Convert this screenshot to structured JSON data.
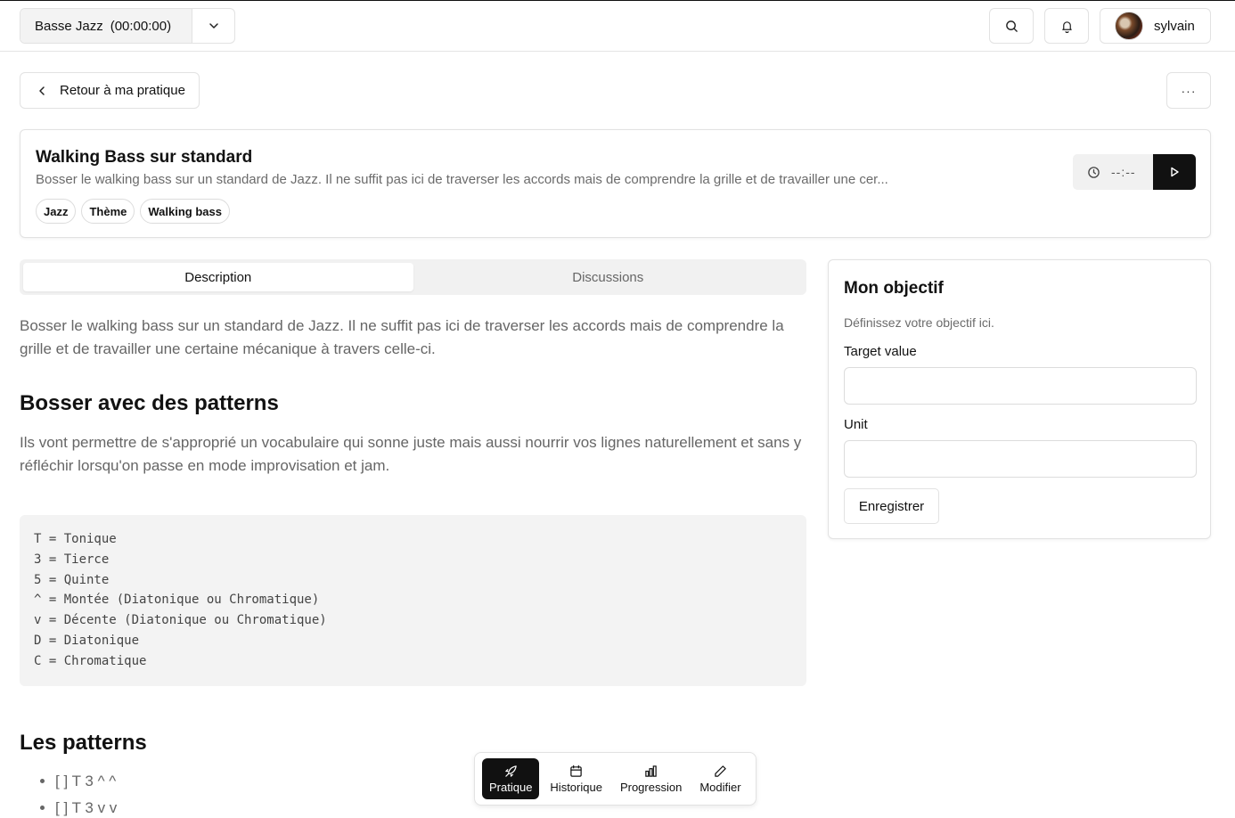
{
  "header": {
    "session_name": "Basse Jazz",
    "session_time": "(00:00:00)",
    "user_name": "sylvain"
  },
  "back": {
    "label": "Retour à ma pratique"
  },
  "more_label": "···",
  "exercise": {
    "title": "Walking Bass sur standard",
    "description": "Bosser le walking bass sur un standard de Jazz. Il ne suffit pas ici de traverser les accords mais de comprendre la grille et de travailler une cer...",
    "tags": [
      "Jazz",
      "Thème",
      "Walking bass"
    ],
    "timer": "--:--"
  },
  "tabs": [
    {
      "label": "Description",
      "active": true
    },
    {
      "label": "Discussions",
      "active": false
    }
  ],
  "content": {
    "intro": "Bosser le walking bass sur un standard de Jazz. Il ne suffit pas ici de traverser les accords mais de comprendre la grille et de travailler une certaine mécanique à travers celle-ci.",
    "h_patterns": "Bosser avec des patterns",
    "patterns_text": "Ils vont permettre de s'approprié un vocabulaire qui sonne juste mais aussi nourrir vos lignes naturellement et sans y réfléchir lorsqu'on passe en mode improvisation et jam.",
    "legend": [
      "T = Tonique",
      "3 = Tierce",
      "5 = Quinte",
      "^ = Montée (Diatonique ou Chromatique)",
      "v = Décente (Diatonique ou Chromatique)",
      "D = Diatonique",
      "C = Chromatique"
    ],
    "h_list": "Les patterns",
    "patterns": [
      "[ ] T 3 ^ ^",
      "[ ] T 3 v v"
    ]
  },
  "objective": {
    "title": "Mon objectif",
    "subtitle": "Définissez votre objectif ici.",
    "target_label": "Target value",
    "target_value": "",
    "unit_label": "Unit",
    "unit_value": "",
    "save_label": "Enregistrer"
  },
  "bottom_nav": {
    "items": [
      {
        "label": "Pratique",
        "icon": "rocket-icon",
        "active": true
      },
      {
        "label": "Historique",
        "icon": "calendar-icon",
        "active": false
      },
      {
        "label": "Progression",
        "icon": "bar-chart-icon",
        "active": false
      },
      {
        "label": "Modifier",
        "icon": "pencil-icon",
        "active": false
      }
    ]
  }
}
